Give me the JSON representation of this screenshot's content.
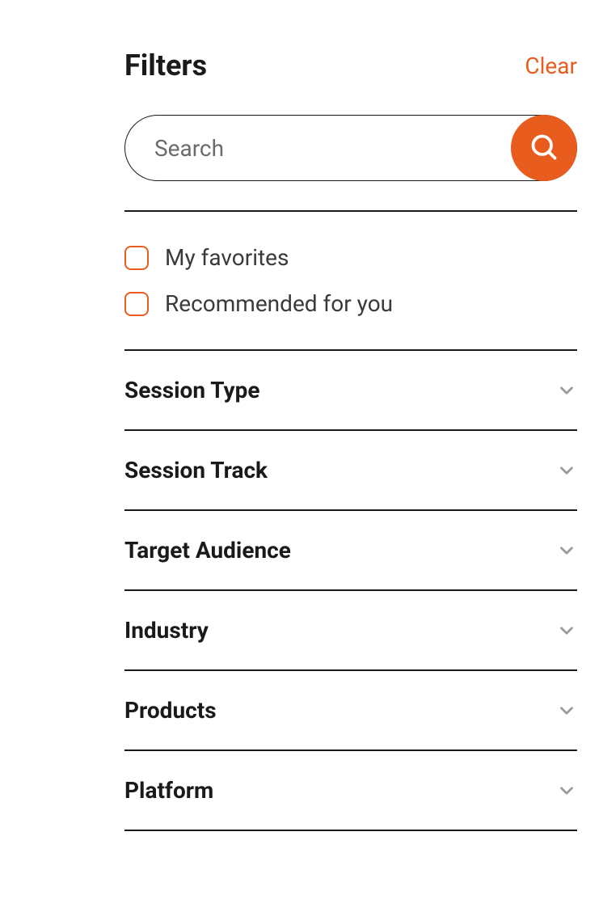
{
  "header": {
    "title": "Filters",
    "clear_label": "Clear"
  },
  "search": {
    "placeholder": "Search",
    "value": ""
  },
  "checkboxes": [
    {
      "label": "My favorites",
      "checked": false
    },
    {
      "label": "Recommended for you",
      "checked": false
    }
  ],
  "filter_groups": [
    {
      "title": "Session Type"
    },
    {
      "title": "Session Track"
    },
    {
      "title": "Target Audience"
    },
    {
      "title": "Industry"
    },
    {
      "title": "Products"
    },
    {
      "title": "Platform"
    }
  ],
  "colors": {
    "accent": "#E85D1E"
  }
}
